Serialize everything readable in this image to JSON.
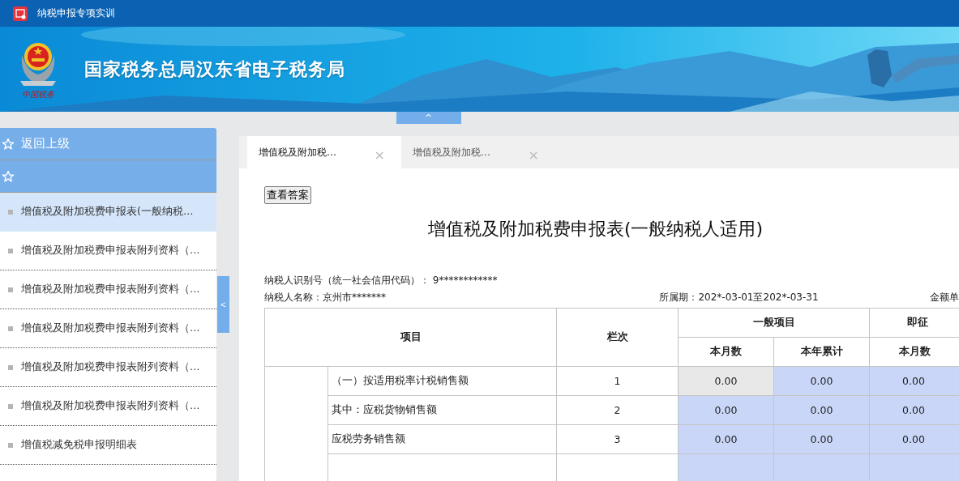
{
  "app_bar": {
    "title": "纳税申报专项实训"
  },
  "banner": {
    "emblem_caption": "中国税务",
    "title": "国家税务总局汉东省电子税务局",
    "collapse_label": "^"
  },
  "sidebar": {
    "back_label": "返回上级",
    "items": [
      {
        "label": "增值税及附加税费申报表(一般纳税…",
        "selected": true
      },
      {
        "label": "增值税及附加税费申报表附列资料（…",
        "selected": false
      },
      {
        "label": "增值税及附加税费申报表附列资料（…",
        "selected": false
      },
      {
        "label": "增值税及附加税费申报表附列资料（…",
        "selected": false
      },
      {
        "label": "增值税及附加税费申报表附列资料（…",
        "selected": false
      },
      {
        "label": "增值税及附加税费申报表附列资料（…",
        "selected": false
      },
      {
        "label": "增值税减免税申报明细表",
        "selected": false
      }
    ],
    "collapse_label": "<"
  },
  "tabs": [
    {
      "label": "增值税及附加税…",
      "close": "×",
      "selected": true
    },
    {
      "label": "增值税及附加税…",
      "close": "×",
      "selected": false
    }
  ],
  "answer_button": "查看答案",
  "form": {
    "title": "增值税及附加税费申报表(一般纳税人适用)",
    "taxpayer_id": "纳税人识别号（统一社会信用代码）： 9************",
    "taxpayer_name": "纳税人名称：京州市*******",
    "period": "所属期：202*-03-01至202*-03-31",
    "unit": "金额单"
  },
  "table": {
    "header": {
      "item": "项目",
      "line": "栏次",
      "group_1": "一般项目",
      "group_2": "即征",
      "sub": [
        "本月数",
        "本年累计",
        "本月数"
      ]
    },
    "rows": [
      {
        "label": "（一）按适用税率计税销售额",
        "line": "1",
        "cells": [
          {
            "value": "0.00",
            "editable": false
          },
          {
            "value": "0.00",
            "editable": true
          },
          {
            "value": "0.00",
            "editable": true
          }
        ]
      },
      {
        "label": "其中：应税货物销售额",
        "line": "2",
        "cells": [
          {
            "value": "0.00",
            "editable": true
          },
          {
            "value": "0.00",
            "editable": true
          },
          {
            "value": "0.00",
            "editable": true
          }
        ]
      },
      {
        "label": "应税劳务销售额",
        "line": "3",
        "cells": [
          {
            "value": "0.00",
            "editable": true
          },
          {
            "value": "0.00",
            "editable": true
          },
          {
            "value": "0.00",
            "editable": true
          }
        ]
      }
    ]
  }
}
